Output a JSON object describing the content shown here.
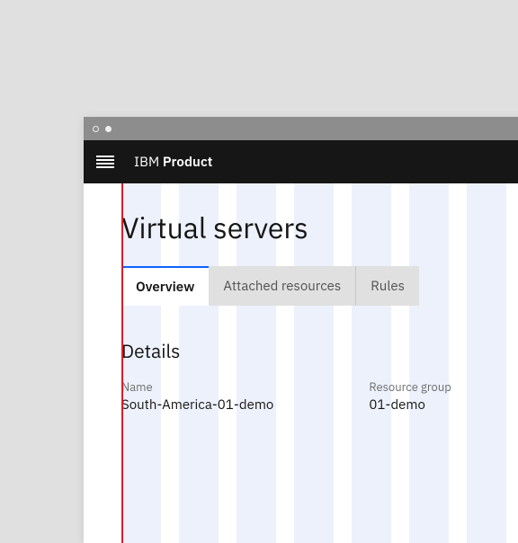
{
  "brand": {
    "company": "IBM",
    "product": "Product"
  },
  "page": {
    "title": "Virtual servers"
  },
  "tabs": {
    "overview": "Overview",
    "attached": "Attached resources",
    "rules": "Rules"
  },
  "details": {
    "heading": "Details",
    "fields": {
      "name": {
        "label": "Name",
        "value": "South-America-01-demo"
      },
      "resource_group": {
        "label": "Resource group",
        "value": "01-demo"
      }
    }
  }
}
